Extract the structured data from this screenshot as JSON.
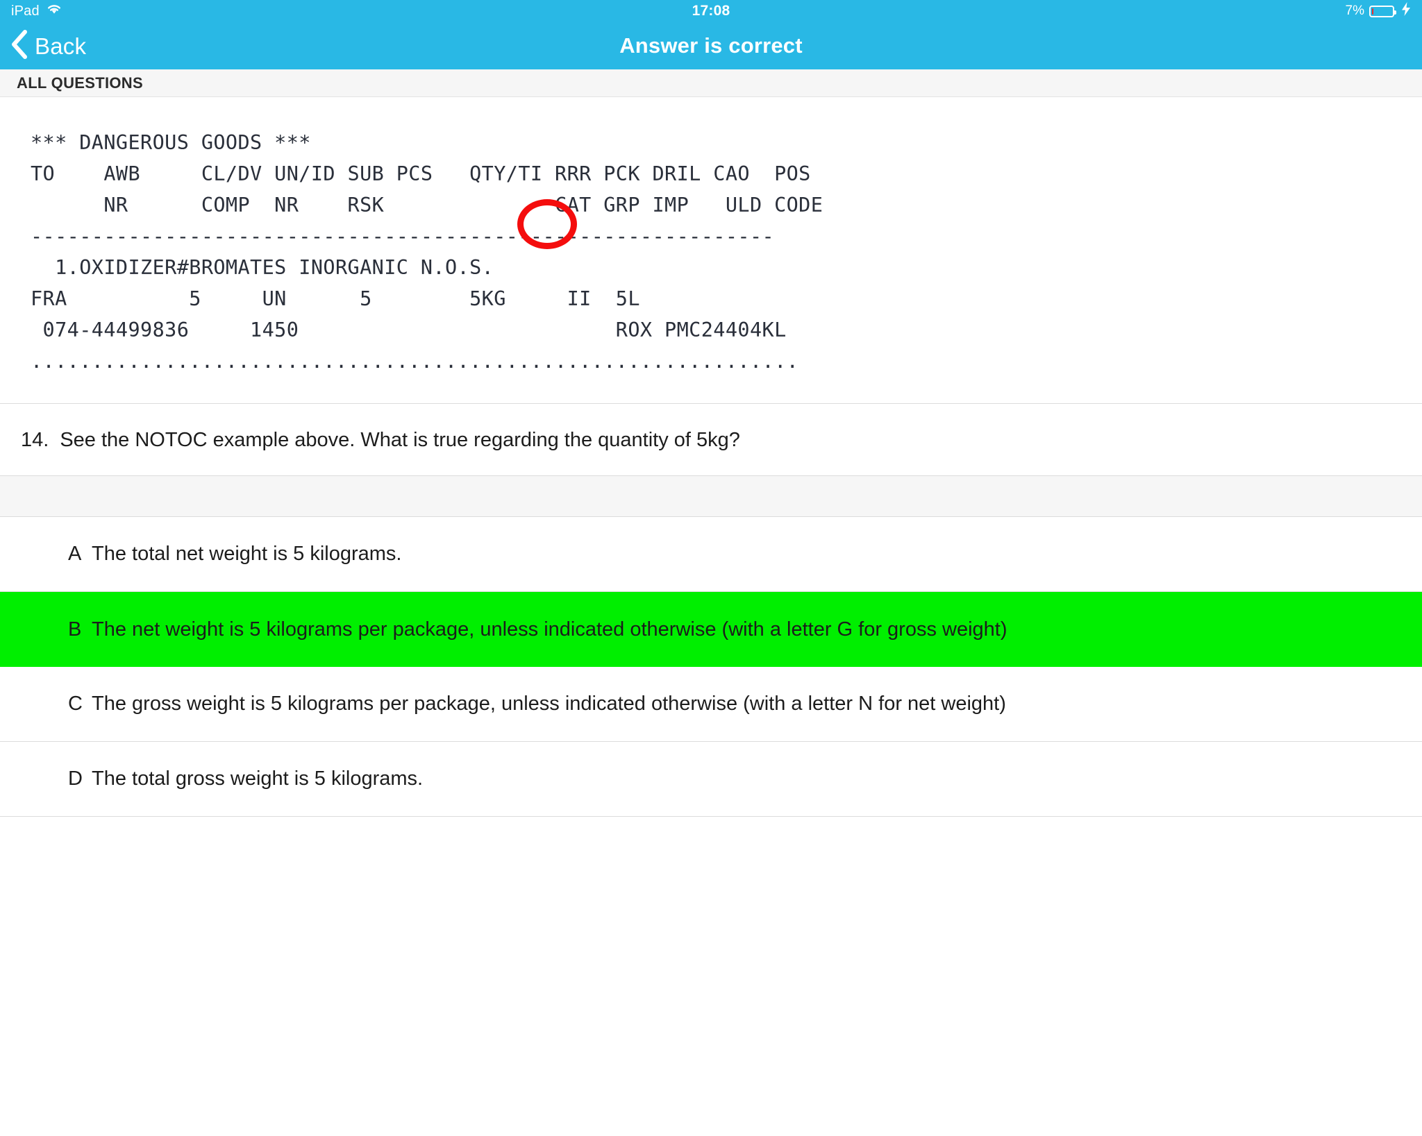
{
  "status_bar": {
    "carrier": "iPad",
    "wifi_icon": "wifi-icon",
    "time": "17:08",
    "battery_percent": "7%",
    "battery_level": 7,
    "charging": true,
    "bolt_icon": "lightning-bolt-icon",
    "bar_color": "#29b8e5",
    "battery_fill_color": "#ec2d2d"
  },
  "nav_bar": {
    "back_label": "Back",
    "back_icon": "chevron-left-icon",
    "title": "Answer is correct"
  },
  "section_header": {
    "label": "ALL QUESTIONS"
  },
  "notoc": {
    "lines": [
      "*** DANGEROUS GOODS ***",
      "TO    AWB     CL/DV UN/ID SUB PCS   QTY/TI RRR PCK DRIL CAO  POS",
      "      NR      COMP  NR    RSK              CAT GRP IMP   ULD CODE",
      "-------------------------------------------------------------",
      "  1.OXIDIZER#BROMATES INORGANIC N.O.S.",
      "FRA          5     UN      5        5KG     II  5L",
      " 074-44499836     1450                          ROX PMC24404KL",
      "..............................................................."
    ],
    "highlight": {
      "value": "5KG",
      "marker": "red-ellipse-annotation",
      "color": "#f40d0d"
    }
  },
  "question": {
    "number": "14.",
    "text": "See the NOTOC example above. What is true regarding the quantity of 5kg?"
  },
  "answers": [
    {
      "letter": "A",
      "text": "The total net weight is 5 kilograms.",
      "correct": false
    },
    {
      "letter": "B",
      "text": "The net weight is 5 kilograms per package, unless indicated otherwise (with a letter G for gross weight)",
      "correct": true
    },
    {
      "letter": "C",
      "text": "The gross weight is 5 kilograms per package, unless indicated otherwise (with a letter N for net weight)",
      "correct": false
    },
    {
      "letter": "D",
      "text": "The total gross weight is 5 kilograms.",
      "correct": false
    }
  ],
  "colors": {
    "accent": "#29b8e5",
    "correct_highlight": "#00ef00",
    "annotation": "#f40d0d"
  }
}
